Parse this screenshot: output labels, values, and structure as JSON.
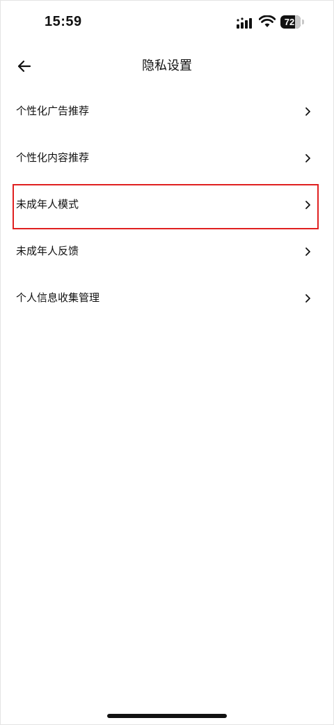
{
  "status_bar": {
    "time": "15:59",
    "battery_level": "72",
    "battery_fraction": 0.72,
    "icons": [
      "signal-icon",
      "wifi-icon",
      "battery-icon"
    ]
  },
  "header": {
    "title": "隐私设置",
    "back_icon": "arrow-left-icon"
  },
  "menu": {
    "items": [
      {
        "label": "个性化广告推荐",
        "icon": "chevron-right-icon"
      },
      {
        "label": "个性化内容推荐",
        "icon": "chevron-right-icon"
      },
      {
        "label": "未成年人模式",
        "icon": "chevron-right-icon",
        "highlighted": true
      },
      {
        "label": "未成年人反馈",
        "icon": "chevron-right-icon"
      },
      {
        "label": "个人信息收集管理",
        "icon": "chevron-right-icon"
      }
    ]
  },
  "colors": {
    "background": "#ffffff",
    "text": "#111111",
    "highlight": "#e02020"
  }
}
